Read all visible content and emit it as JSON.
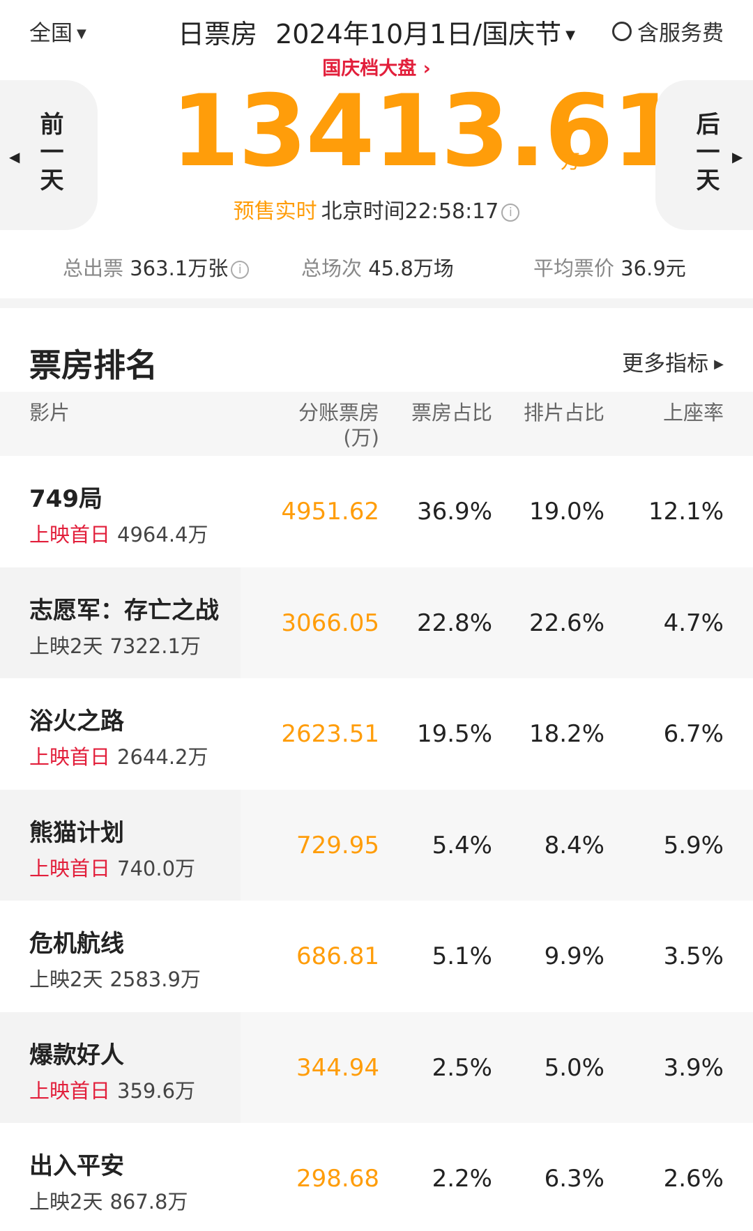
{
  "header": {
    "region": "全国",
    "title_type": "日票房",
    "date": "2024年10月1日/国庆节",
    "service_fee_label": "含服务费",
    "festival_link": "国庆档大盘"
  },
  "hero": {
    "prev_label": "前一天",
    "next_label": "后一天",
    "total": "13413.61",
    "unit": "万",
    "realtime_label": "预售实时",
    "beijing_time": "北京时间22:58:17"
  },
  "stats": {
    "tickets_label": "总出票",
    "tickets_value": "363.1万张",
    "shows_label": "总场次",
    "shows_value": "45.8万场",
    "avg_price_label": "平均票价",
    "avg_price_value": "36.9元"
  },
  "ranking": {
    "title": "票房排名",
    "more_label": "更多指标",
    "columns": {
      "film": "影片",
      "box_office_line1": "分账票房",
      "box_office_line2": "(万)",
      "box_share": "票房占比",
      "schedule_share": "排片占比",
      "occupancy": "上座率"
    },
    "rows": [
      {
        "name": "749局",
        "days": "上映首日",
        "days_red": true,
        "cumulative": "4964.4万",
        "box": "4951.62",
        "box_share": "36.9%",
        "schedule_share": "19.0%",
        "occupancy": "12.1%"
      },
      {
        "name": "志愿军：存亡之战",
        "days": "上映2天",
        "days_red": false,
        "cumulative": "7322.1万",
        "box": "3066.05",
        "box_share": "22.8%",
        "schedule_share": "22.6%",
        "occupancy": "4.7%"
      },
      {
        "name": "浴火之路",
        "days": "上映首日",
        "days_red": true,
        "cumulative": "2644.2万",
        "box": "2623.51",
        "box_share": "19.5%",
        "schedule_share": "18.2%",
        "occupancy": "6.7%"
      },
      {
        "name": "熊猫计划",
        "days": "上映首日",
        "days_red": true,
        "cumulative": "740.0万",
        "box": "729.95",
        "box_share": "5.4%",
        "schedule_share": "8.4%",
        "occupancy": "5.9%"
      },
      {
        "name": "危机航线",
        "days": "上映2天",
        "days_red": false,
        "cumulative": "2583.9万",
        "box": "686.81",
        "box_share": "5.1%",
        "schedule_share": "9.9%",
        "occupancy": "3.5%"
      },
      {
        "name": "爆款好人",
        "days": "上映首日",
        "days_red": true,
        "cumulative": "359.6万",
        "box": "344.94",
        "box_share": "2.5%",
        "schedule_share": "5.0%",
        "occupancy": "3.9%"
      },
      {
        "name": "出入平安",
        "days": "上映2天",
        "days_red": false,
        "cumulative": "867.8万",
        "box": "298.68",
        "box_share": "2.2%",
        "schedule_share": "6.3%",
        "occupancy": "2.6%"
      }
    ]
  },
  "colors": {
    "accent_orange": "#ff9d0a",
    "accent_red": "#e21f3b"
  }
}
